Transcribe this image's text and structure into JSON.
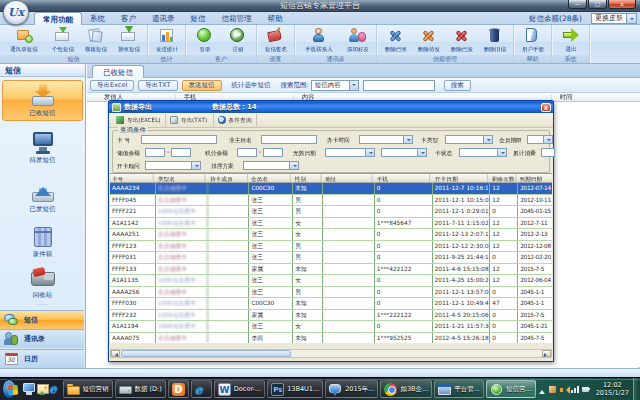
{
  "window": {
    "title": "短信营销专家管理平台",
    "logo": "Ux",
    "close_glyph": "x",
    "minimize_glyph": "—",
    "maximize_glyph": "□"
  },
  "tabs": {
    "items": [
      "常用功能",
      "系统",
      "客户",
      "通讯录",
      "短信",
      "信箱管理",
      "帮助"
    ],
    "active_index": 0,
    "balance_label": "短信余额(28条)",
    "skin_select_value": "更换皮肤"
  },
  "ribbon": {
    "groups": [
      {
        "label": "短信",
        "buttons": [
          {
            "label": "通讯录短信",
            "icon": "env-contact"
          },
          {
            "label": "个性短信",
            "icon": "env-down"
          },
          {
            "label": "模板短信",
            "icon": "papers"
          },
          {
            "label": "接收短信",
            "icon": "env-recv"
          }
        ]
      },
      {
        "label": "统计",
        "buttons": [
          {
            "label": "发送统计",
            "icon": "chart"
          }
        ]
      },
      {
        "label": "客户",
        "buttons": [
          {
            "label": "登录",
            "icon": "ball"
          },
          {
            "label": "注销",
            "icon": "globe"
          }
        ]
      },
      {
        "label": "设置",
        "buttons": [
          {
            "label": "短信签名",
            "icon": "book-red"
          }
        ]
      },
      {
        "label": "通讯录",
        "buttons": [
          {
            "label": "手机联系人",
            "icon": "person"
          },
          {
            "label": "添加好友",
            "icon": "person-add"
          }
        ]
      },
      {
        "label": "信箱管理",
        "buttons": [
          {
            "label": "删除已收",
            "icon": "x-blue"
          },
          {
            "label": "删除待发",
            "icon": "x-orange"
          },
          {
            "label": "删除已发",
            "icon": "x-red"
          },
          {
            "label": "删除旧信",
            "icon": "trash"
          }
        ]
      },
      {
        "label": "帮助",
        "buttons": [
          {
            "label": "用户手册",
            "icon": "book-blue"
          }
        ]
      },
      {
        "label": "系统",
        "buttons": [
          {
            "label": "退出",
            "icon": "arrow-exit"
          }
        ]
      }
    ]
  },
  "sidebar": {
    "header": "短信",
    "splitter_glyph": "····",
    "items": [
      {
        "label": "已收短信",
        "icon": "inbox",
        "selected": true
      },
      {
        "label": "待发短信",
        "icon": "pending"
      },
      {
        "label": "已发短信",
        "icon": "sent"
      },
      {
        "label": "废件箱",
        "icon": "drafts"
      },
      {
        "label": "回收站",
        "icon": "recycle"
      }
    ],
    "nav": [
      {
        "label": "短信",
        "icon": "sms",
        "selected": true
      },
      {
        "label": "通讯录",
        "icon": "contacts"
      },
      {
        "label": "日历",
        "icon": "calendar",
        "badge": "30"
      }
    ]
  },
  "main": {
    "tab": "已收短信",
    "toolbar": {
      "export_excel": "导出Excel",
      "export_txt": "导出TXT",
      "send_sms": "发送短信",
      "stat_label": "统计选中短信",
      "search_scope_label": "搜索范围:",
      "scope_value": "短信内容",
      "search_placeholder": "",
      "search_button": "搜索"
    },
    "table_headers": [
      "发信人",
      "手机",
      "内容",
      "时间"
    ]
  },
  "dialog": {
    "title": "数据导出",
    "count_label": "数据总数：14",
    "close_glyph": "x",
    "toolbar": [
      "导出(EXCEL)",
      "导出(TXT)",
      "条件查询"
    ],
    "form": {
      "legend": "查询条件",
      "range_dash": "-",
      "card_no": "卡  号",
      "owner_name": "业主姓名",
      "open_time": "办卡时间",
      "card_type": "卡类型",
      "member_term": "会员期限",
      "stored_balance": "储值余额",
      "points_balance": "积分余额",
      "invalid_date": "无效日期",
      "card_status": "卡状态",
      "total_consume": "累计消费",
      "advisor": "开卡顾问",
      "sort_plan": "排序方案"
    },
    "table": {
      "headers": [
        "卡号",
        "类型名",
        "持卡成员",
        "会员名",
        "性别",
        "地址",
        "手机",
        "开卡日期",
        "剩余次数",
        "到期日期"
      ],
      "rows": [
        {
          "sel": true,
          "cells": [
            "AAAA234",
            "会员储值卡",
            "",
            "C00C30",
            "未知",
            "",
            "0",
            "2011-12-7 10:16:12",
            "12",
            "2012-07-14"
          ]
        },
        {
          "cells": [
            "FFFF045",
            "会员储值卡",
            "",
            "张三",
            "男",
            "",
            "0",
            "2011-12-1 10:15:01",
            "12",
            "2012-10-11"
          ]
        },
        {
          "t2": true,
          "cells": [
            "FFFF221",
            "1000元充值卡",
            "",
            "张三",
            "男",
            "",
            "0",
            "2011-12-1 0:29:01",
            "0",
            "2045-01-15"
          ]
        },
        {
          "t2": true,
          "cells": [
            "A1A1142",
            "1000元充值卡",
            "",
            "张三",
            "女",
            "",
            "1***845647",
            "2011-7-11 1:15:02",
            "12",
            "2012-7-11"
          ]
        },
        {
          "cells": [
            "AAAA251",
            "会员储值卡",
            "",
            "张三",
            "女",
            "",
            "0",
            "2011-12-13 2:07:11",
            "12",
            "2012-2-13"
          ]
        },
        {
          "cells": [
            "FFFF123",
            "会员储值卡",
            "",
            "张三",
            "男",
            "",
            "0",
            "2011-12-12 2:30:05",
            "12",
            "2012-12-08"
          ]
        },
        {
          "cells": [
            "FFFF031",
            "会员储值卡",
            "",
            "张三",
            "男",
            "",
            "0",
            "2011-9-25 21:44:10",
            "0",
            "2012-02-20"
          ]
        },
        {
          "cells": [
            "FFFF133",
            "会员储值卡",
            "",
            "家属",
            "未知",
            "",
            "1***422122",
            "2011-4-6 15:15:08",
            "12",
            "2015-7-5"
          ]
        },
        {
          "t2": true,
          "cells": [
            "A1A1135",
            "1000元充值卡",
            "",
            "张三",
            "女",
            "",
            "0",
            "2011-4-25 15:00:21",
            "12",
            "2012-06-04"
          ]
        },
        {
          "cells": [
            "AAAA256",
            "会员储值卡",
            "",
            "张三",
            "男",
            "",
            "0",
            "2011-12-1 13:57:09",
            "0",
            "2045-1-1"
          ]
        },
        {
          "t2": true,
          "cells": [
            "FFFF030",
            "1000元充值卡",
            "",
            "C00C30",
            "未知",
            "",
            "0",
            "2011-12-1 10:49:47",
            "47",
            "2045-1-1"
          ]
        },
        {
          "t2": true,
          "cells": [
            "FFFF232",
            "1000元充值卡",
            "",
            "家属",
            "未知",
            "",
            "1***222122",
            "2011-4-5 20:15:06",
            "0",
            "2015-7-5"
          ]
        },
        {
          "t2": true,
          "cells": [
            "A1A1194",
            "1000元充值卡",
            "",
            "张三",
            "女",
            "",
            "0",
            "2011-1-21 11:57:30",
            "0",
            "2045-1-21"
          ]
        },
        {
          "cells": [
            "AAAA075",
            "会员储值卡",
            "",
            "李四",
            "未知",
            "",
            "1***952525",
            "2012-4-5 15:26:18",
            "0",
            "2045-7-5"
          ]
        }
      ]
    }
  },
  "taskbar": {
    "buttons": [
      {
        "icon": "folder",
        "label": "短信营销"
      },
      {
        "icon": "drive",
        "label": "数据 (D:)"
      },
      {
        "icon": "dorange",
        "label": ""
      },
      {
        "icon": "ie",
        "label": ""
      },
      {
        "icon": "word",
        "label": "Docer-..."
      },
      {
        "icon": "ps",
        "label": "13B4U1..."
      },
      {
        "icon": "chat",
        "label": "2015年..."
      },
      {
        "icon": "chrome",
        "label": "如3B企..."
      },
      {
        "icon": "winblue",
        "label": "平台管..."
      },
      {
        "icon": "appgreen",
        "label": "短信营...",
        "active": true
      }
    ],
    "word_glyph": "W",
    "ps_glyph": "Ps",
    "d_glyph": "D",
    "ie_glyph": "e",
    "clock": {
      "time": "12:02",
      "date": "2015/1/27"
    }
  }
}
